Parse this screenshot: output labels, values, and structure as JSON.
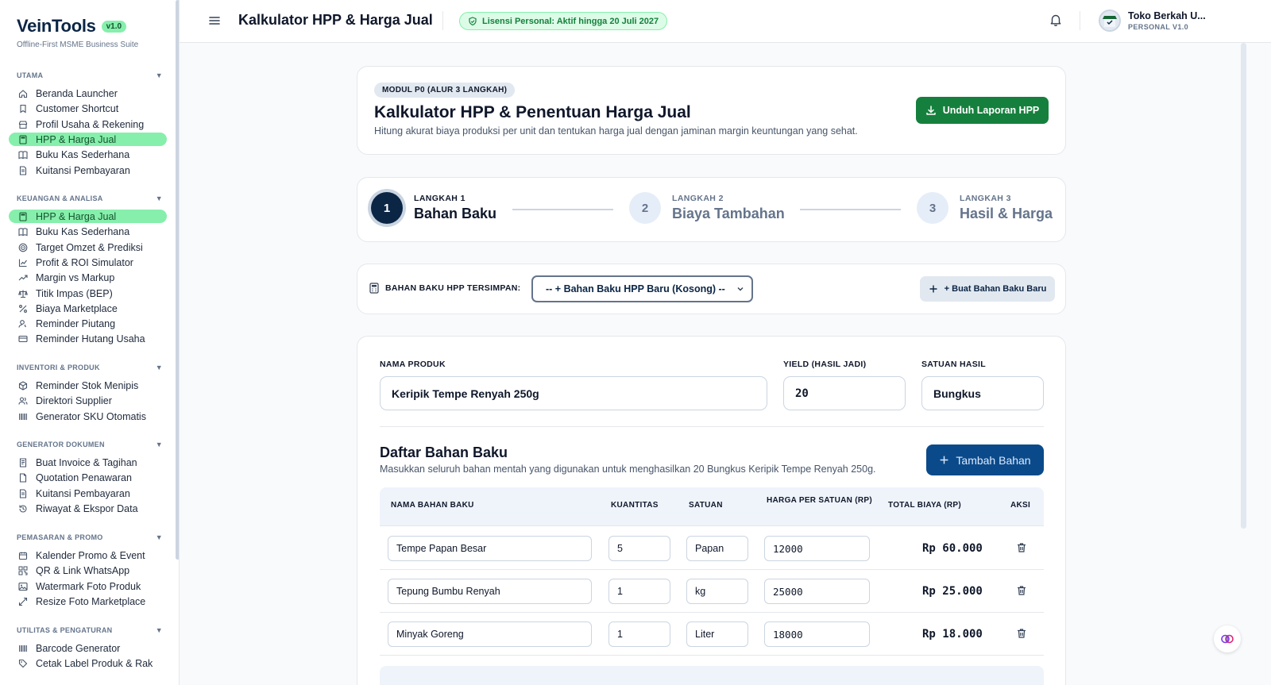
{
  "brand": {
    "name": "VeinTools",
    "version": "v1.0",
    "subtitle": "Offline-First MSME Business Suite"
  },
  "sidebar": {
    "sections": [
      {
        "title": "UTAMA",
        "items": [
          {
            "label": "Beranda Launcher",
            "icon": "home-icon"
          },
          {
            "label": "Customer Shortcut",
            "icon": "bookmark-icon"
          },
          {
            "label": "Profil Usaha & Rekening",
            "icon": "store-icon"
          },
          {
            "label": "HPP & Harga Jual",
            "icon": "calculator-icon",
            "active": true
          },
          {
            "label": "Buku Kas Sederhana",
            "icon": "book-icon"
          },
          {
            "label": "Kuitansi Pembayaran",
            "icon": "receipt-icon"
          }
        ]
      },
      {
        "title": "KEUANGAN & ANALISA",
        "items": [
          {
            "label": "HPP & Harga Jual",
            "icon": "calculator-icon",
            "active": true
          },
          {
            "label": "Buku Kas Sederhana",
            "icon": "book-icon"
          },
          {
            "label": "Target Omzet & Prediksi",
            "icon": "target-icon"
          },
          {
            "label": "Profit & ROI Simulator",
            "icon": "chart-icon"
          },
          {
            "label": "Margin vs Markup",
            "icon": "trend-icon"
          },
          {
            "label": "Titik Impas (BEP)",
            "icon": "scale-icon"
          },
          {
            "label": "Biaya Marketplace",
            "icon": "percent-icon"
          },
          {
            "label": "Reminder Piutang",
            "icon": "user-clock-icon"
          },
          {
            "label": "Reminder Hutang Usaha",
            "icon": "card-icon"
          }
        ]
      },
      {
        "title": "INVENTORI & PRODUK",
        "items": [
          {
            "label": "Reminder Stok Menipis",
            "icon": "box-icon"
          },
          {
            "label": "Direktori Supplier",
            "icon": "users-icon"
          },
          {
            "label": "Generator SKU Otomatis",
            "icon": "barcode-icon"
          }
        ]
      },
      {
        "title": "GENERATOR DOKUMEN",
        "items": [
          {
            "label": "Buat Invoice & Tagihan",
            "icon": "invoice-icon"
          },
          {
            "label": "Quotation Penawaran",
            "icon": "document-icon"
          },
          {
            "label": "Kuitansi Pembayaran",
            "icon": "receipt-icon"
          },
          {
            "label": "Riwayat & Ekspor Data",
            "icon": "history-icon"
          }
        ]
      },
      {
        "title": "PEMASARAN & PROMO",
        "items": [
          {
            "label": "Kalender Promo & Event",
            "icon": "calendar-icon"
          },
          {
            "label": "QR & Link WhatsApp",
            "icon": "qr-icon"
          },
          {
            "label": "Watermark Foto Produk",
            "icon": "image-icon"
          },
          {
            "label": "Resize Foto Marketplace",
            "icon": "resize-icon"
          }
        ]
      },
      {
        "title": "UTILITAS & PENGATURAN",
        "items": [
          {
            "label": "Barcode Generator",
            "icon": "barcode-icon"
          },
          {
            "label": "Cetak Label Produk & Rak",
            "icon": "tag-icon"
          }
        ]
      }
    ]
  },
  "header": {
    "title": "Kalkulator HPP & Harga Jual",
    "license": "Lisensi Personal: Aktif hingga 20 Juli 2027",
    "user_name": "Toko Berkah U...",
    "user_plan": "PERSONAL V1.0"
  },
  "intro": {
    "tag": "MODUL P0 (ALUR 3 LANGKAH)",
    "title": "Kalkulator HPP & Penentuan Harga Jual",
    "subtitle": "Hitung akurat biaya produksi per unit dan tentukan harga jual dengan jaminan margin keuntungan yang sehat.",
    "download_label": "Unduh Laporan HPP"
  },
  "steps": [
    {
      "number": "1",
      "label": "LANGKAH 1",
      "name": "Bahan Baku",
      "active": true
    },
    {
      "number": "2",
      "label": "LANGKAH 2",
      "name": "Biaya Tambahan",
      "active": false
    },
    {
      "number": "3",
      "label": "LANGKAH 3",
      "name": "Hasil & Harga",
      "active": false
    }
  ],
  "saved": {
    "label": "BAHAN BAKU HPP TERSIMPAN:",
    "selected": "-- + Bahan Baku HPP Baru (Kosong) --",
    "new_button": "+ Buat Bahan Baku Baru"
  },
  "form": {
    "product_label": "NAMA PRODUK",
    "product_value": "Keripik Tempe Renyah 250g",
    "yield_label": "YIELD (HASIL JADI)",
    "yield_value": "20",
    "unit_label": "SATUAN HASIL",
    "unit_value": "Bungkus"
  },
  "materials": {
    "title": "Daftar Bahan Baku",
    "subtitle": "Masukkan seluruh bahan mentah yang digunakan untuk menghasilkan 20 Bungkus Keripik Tempe Renyah 250g.",
    "add_button": "Tambah Bahan",
    "columns": [
      "NAMA BAHAN BAKU",
      "KUANTITAS",
      "SATUAN",
      "HARGA PER SATUAN (RP)",
      "TOTAL BIAYA (RP)",
      "AKSI"
    ],
    "rows": [
      {
        "name": "Tempe Papan Besar",
        "qty": "5",
        "unit": "Papan",
        "price": "12000",
        "total": "Rp 60.000"
      },
      {
        "name": "Tepung Bumbu Renyah",
        "qty": "1",
        "unit": "kg",
        "price": "25000",
        "total": "Rp 25.000"
      },
      {
        "name": "Minyak Goreng",
        "qty": "1",
        "unit": "Liter",
        "price": "18000",
        "total": "Rp 18.000"
      }
    ]
  },
  "colors": {
    "navy": "#0b2545",
    "green": "#15803d",
    "active_bg": "#86efac"
  }
}
